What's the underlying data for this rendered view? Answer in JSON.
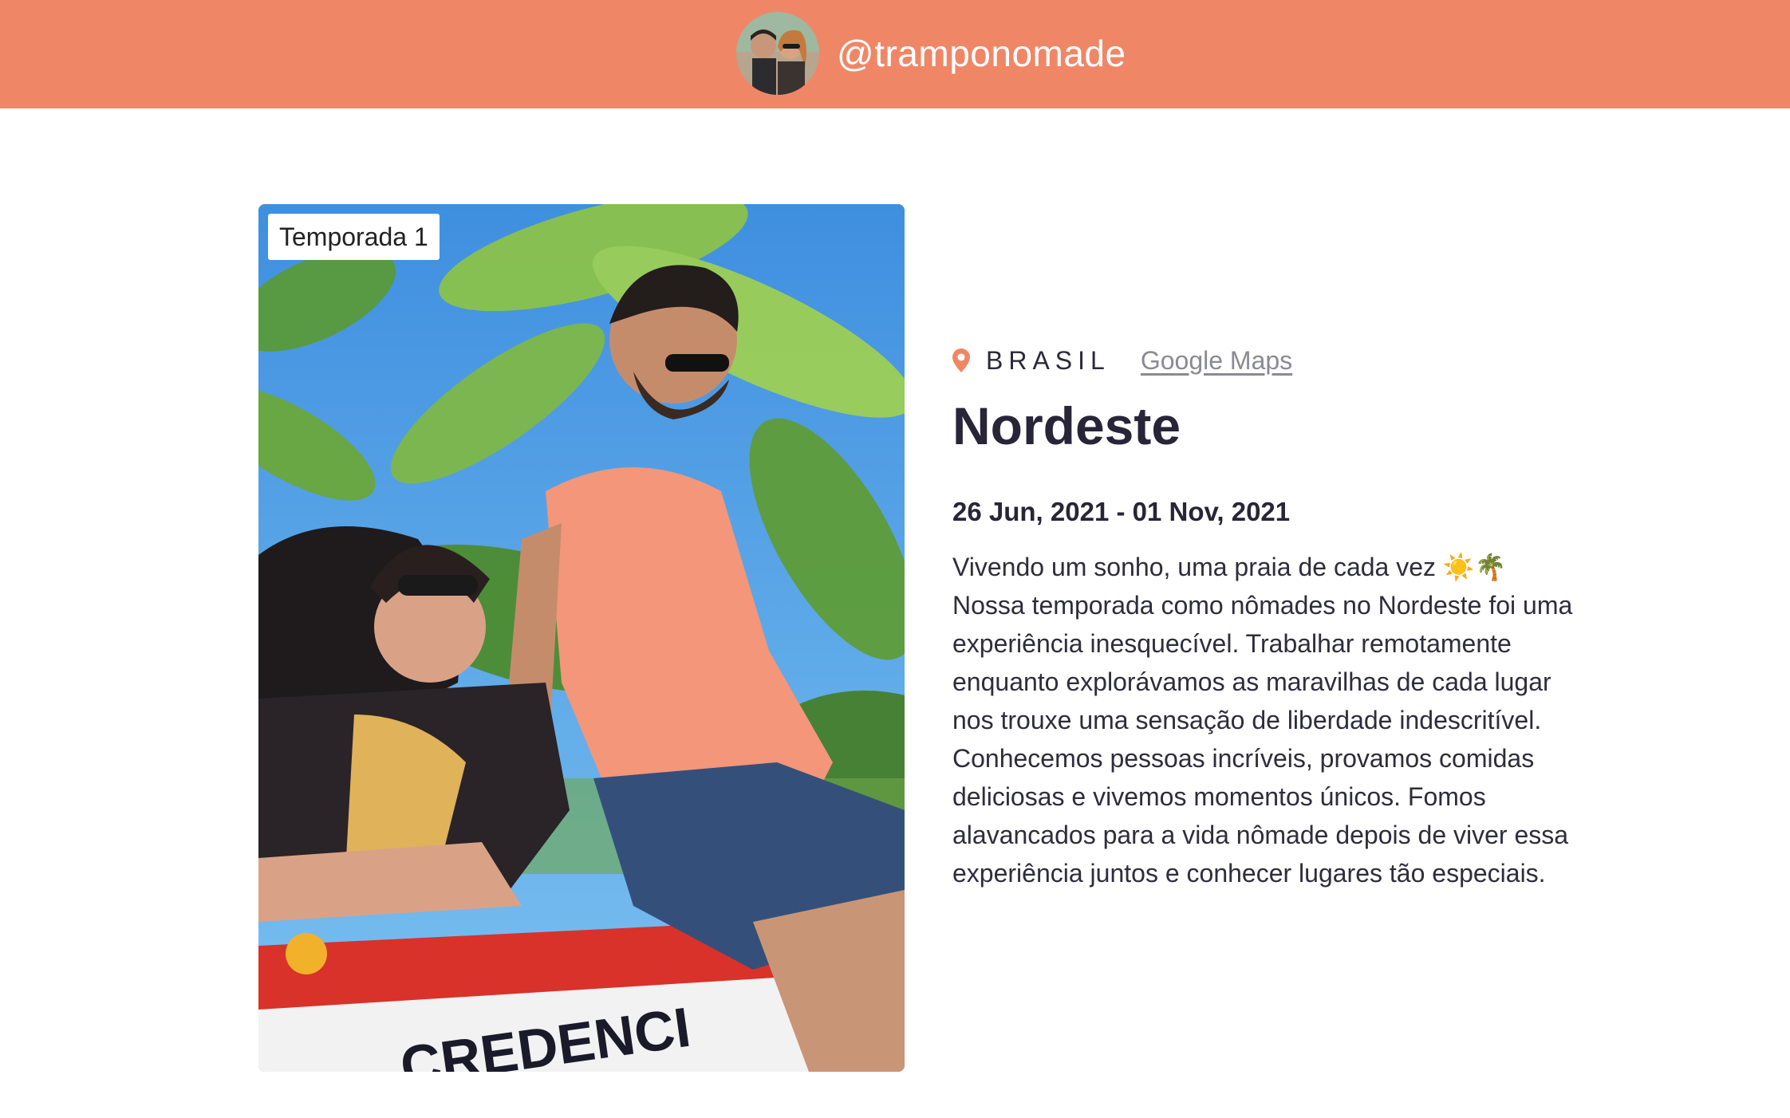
{
  "header": {
    "handle": "@tramponomade",
    "bg_color": "#ef8767"
  },
  "card": {
    "badge": "Temporada 1",
    "photo_icon": "beach-couple-photo"
  },
  "info": {
    "location_icon": "map-pin-icon",
    "country": "BRASIL",
    "maps_link": "Google Maps",
    "title": "Nordeste",
    "dates": "26 Jun, 2021 - 01 Nov, 2021",
    "description": "Vivendo um sonho, uma praia de cada vez ☀️🌴\nNossa temporada como nômades no Nordeste foi uma experiência inesquecível. Trabalhar remotamente enquanto explorávamos as maravilhas de cada lugar nos trouxe uma sensação de liberdade indescritível. Conhecemos pessoas incríveis, provamos comidas deliciosas e vivemos momentos únicos. Fomos alavancados para a vida nômade depois de viver essa experiência juntos e conhecer lugares tão especiais.",
    "accent_color": "#ef8767"
  }
}
